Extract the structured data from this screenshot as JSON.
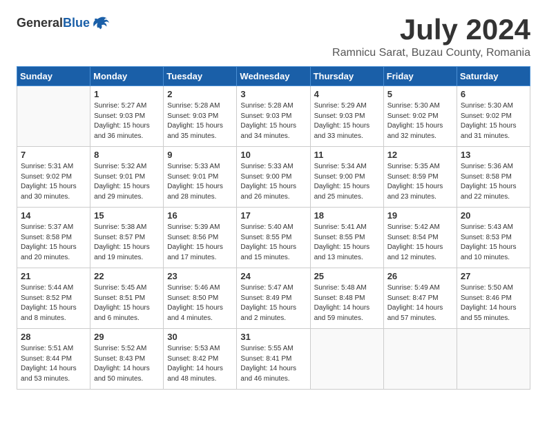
{
  "logo": {
    "general": "General",
    "blue": "Blue"
  },
  "title": {
    "month_year": "July 2024",
    "location": "Ramnicu Sarat, Buzau County, Romania"
  },
  "days_of_week": [
    "Sunday",
    "Monday",
    "Tuesday",
    "Wednesday",
    "Thursday",
    "Friday",
    "Saturday"
  ],
  "weeks": [
    [
      {
        "day": "",
        "info": ""
      },
      {
        "day": "1",
        "info": "Sunrise: 5:27 AM\nSunset: 9:03 PM\nDaylight: 15 hours\nand 36 minutes."
      },
      {
        "day": "2",
        "info": "Sunrise: 5:28 AM\nSunset: 9:03 PM\nDaylight: 15 hours\nand 35 minutes."
      },
      {
        "day": "3",
        "info": "Sunrise: 5:28 AM\nSunset: 9:03 PM\nDaylight: 15 hours\nand 34 minutes."
      },
      {
        "day": "4",
        "info": "Sunrise: 5:29 AM\nSunset: 9:03 PM\nDaylight: 15 hours\nand 33 minutes."
      },
      {
        "day": "5",
        "info": "Sunrise: 5:30 AM\nSunset: 9:02 PM\nDaylight: 15 hours\nand 32 minutes."
      },
      {
        "day": "6",
        "info": "Sunrise: 5:30 AM\nSunset: 9:02 PM\nDaylight: 15 hours\nand 31 minutes."
      }
    ],
    [
      {
        "day": "7",
        "info": "Sunrise: 5:31 AM\nSunset: 9:02 PM\nDaylight: 15 hours\nand 30 minutes."
      },
      {
        "day": "8",
        "info": "Sunrise: 5:32 AM\nSunset: 9:01 PM\nDaylight: 15 hours\nand 29 minutes."
      },
      {
        "day": "9",
        "info": "Sunrise: 5:33 AM\nSunset: 9:01 PM\nDaylight: 15 hours\nand 28 minutes."
      },
      {
        "day": "10",
        "info": "Sunrise: 5:33 AM\nSunset: 9:00 PM\nDaylight: 15 hours\nand 26 minutes."
      },
      {
        "day": "11",
        "info": "Sunrise: 5:34 AM\nSunset: 9:00 PM\nDaylight: 15 hours\nand 25 minutes."
      },
      {
        "day": "12",
        "info": "Sunrise: 5:35 AM\nSunset: 8:59 PM\nDaylight: 15 hours\nand 23 minutes."
      },
      {
        "day": "13",
        "info": "Sunrise: 5:36 AM\nSunset: 8:58 PM\nDaylight: 15 hours\nand 22 minutes."
      }
    ],
    [
      {
        "day": "14",
        "info": "Sunrise: 5:37 AM\nSunset: 8:58 PM\nDaylight: 15 hours\nand 20 minutes."
      },
      {
        "day": "15",
        "info": "Sunrise: 5:38 AM\nSunset: 8:57 PM\nDaylight: 15 hours\nand 19 minutes."
      },
      {
        "day": "16",
        "info": "Sunrise: 5:39 AM\nSunset: 8:56 PM\nDaylight: 15 hours\nand 17 minutes."
      },
      {
        "day": "17",
        "info": "Sunrise: 5:40 AM\nSunset: 8:55 PM\nDaylight: 15 hours\nand 15 minutes."
      },
      {
        "day": "18",
        "info": "Sunrise: 5:41 AM\nSunset: 8:55 PM\nDaylight: 15 hours\nand 13 minutes."
      },
      {
        "day": "19",
        "info": "Sunrise: 5:42 AM\nSunset: 8:54 PM\nDaylight: 15 hours\nand 12 minutes."
      },
      {
        "day": "20",
        "info": "Sunrise: 5:43 AM\nSunset: 8:53 PM\nDaylight: 15 hours\nand 10 minutes."
      }
    ],
    [
      {
        "day": "21",
        "info": "Sunrise: 5:44 AM\nSunset: 8:52 PM\nDaylight: 15 hours\nand 8 minutes."
      },
      {
        "day": "22",
        "info": "Sunrise: 5:45 AM\nSunset: 8:51 PM\nDaylight: 15 hours\nand 6 minutes."
      },
      {
        "day": "23",
        "info": "Sunrise: 5:46 AM\nSunset: 8:50 PM\nDaylight: 15 hours\nand 4 minutes."
      },
      {
        "day": "24",
        "info": "Sunrise: 5:47 AM\nSunset: 8:49 PM\nDaylight: 15 hours\nand 2 minutes."
      },
      {
        "day": "25",
        "info": "Sunrise: 5:48 AM\nSunset: 8:48 PM\nDaylight: 14 hours\nand 59 minutes."
      },
      {
        "day": "26",
        "info": "Sunrise: 5:49 AM\nSunset: 8:47 PM\nDaylight: 14 hours\nand 57 minutes."
      },
      {
        "day": "27",
        "info": "Sunrise: 5:50 AM\nSunset: 8:46 PM\nDaylight: 14 hours\nand 55 minutes."
      }
    ],
    [
      {
        "day": "28",
        "info": "Sunrise: 5:51 AM\nSunset: 8:44 PM\nDaylight: 14 hours\nand 53 minutes."
      },
      {
        "day": "29",
        "info": "Sunrise: 5:52 AM\nSunset: 8:43 PM\nDaylight: 14 hours\nand 50 minutes."
      },
      {
        "day": "30",
        "info": "Sunrise: 5:53 AM\nSunset: 8:42 PM\nDaylight: 14 hours\nand 48 minutes."
      },
      {
        "day": "31",
        "info": "Sunrise: 5:55 AM\nSunset: 8:41 PM\nDaylight: 14 hours\nand 46 minutes."
      },
      {
        "day": "",
        "info": ""
      },
      {
        "day": "",
        "info": ""
      },
      {
        "day": "",
        "info": ""
      }
    ]
  ]
}
